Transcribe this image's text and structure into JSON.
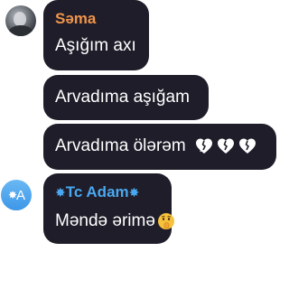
{
  "messages": [
    {
      "sender": "Səma",
      "text": "Aşığım axı",
      "avatar": "photo-avatar",
      "sender_color": "#f0944b"
    },
    {
      "text": "Arvadıma aşığam"
    },
    {
      "text": "Arvadıma ölərəm",
      "trailing_icons": [
        "heart-icon",
        "heart-icon",
        "heart-icon"
      ]
    },
    {
      "sender_prefix": "✸",
      "sender": "Tc Adam",
      "sender_suffix": "✸",
      "avatar_letter": "A",
      "avatar_prefix": "✸",
      "text": "Məndə ərimə",
      "trailing_icons": [
        "shushing-face-icon"
      ],
      "sender_color": "#4aa8f0"
    }
  ],
  "colors": {
    "bubble": "#1f1d29",
    "background": "#ffffff",
    "avatar_blue": "#3d97e8"
  }
}
